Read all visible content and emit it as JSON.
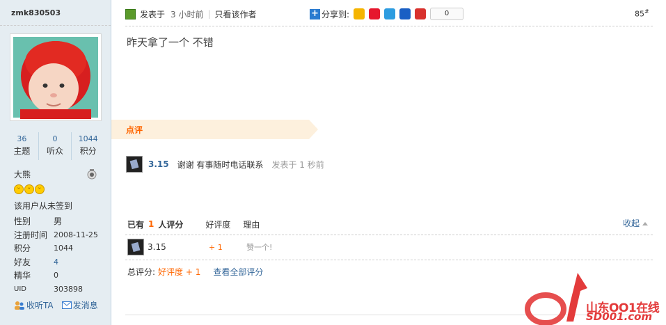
{
  "user": {
    "name": "zmk830503",
    "stats": [
      {
        "num": "36",
        "label": "主题"
      },
      {
        "num": "0",
        "label": "听众"
      },
      {
        "num": "1044",
        "label": "积分"
      }
    ],
    "group": "大熊",
    "sign_status": "该用户从未签到",
    "info": [
      {
        "k": "性别",
        "v": "男"
      },
      {
        "k": "注册时间",
        "v": "2008-11-25"
      },
      {
        "k": "积分",
        "v": "1044"
      },
      {
        "k": "好友",
        "v": "4"
      },
      {
        "k": "精华",
        "v": "0"
      },
      {
        "k": "UID",
        "v": "303898"
      }
    ],
    "actions": {
      "follow": "收听TA",
      "message": "发消息"
    }
  },
  "post": {
    "posted_prefix": "发表于",
    "posted_time": "3 小时前",
    "only_author": "只看该作者",
    "share_label": "分享到:",
    "share_count": "0",
    "floor": "85",
    "floor_mark": "#",
    "message": "昨天拿了一个  不错"
  },
  "comments": {
    "label": "点评",
    "items": [
      {
        "user": "3.15",
        "text": "谢谢  有事随时电话联系",
        "meta": "发表于 1 秒前"
      }
    ]
  },
  "ratings": {
    "prefix": "已有",
    "count": "1",
    "suffix": "人评分",
    "col_score": "好评度",
    "col_reason": "理由",
    "collapse": "收起",
    "rows": [
      {
        "user": "3.15",
        "score": "+ 1",
        "reason": "赞一个!"
      }
    ],
    "total_label": "总评分:",
    "total_value": "好评度  + 1",
    "view_all": "查看全部评分"
  },
  "watermark": {
    "line1": "山东OO1在线",
    "line2": "SD001.com"
  },
  "colors": {
    "accent": "#ff6600",
    "link": "#336699",
    "sidebar": "#e5edf2"
  }
}
